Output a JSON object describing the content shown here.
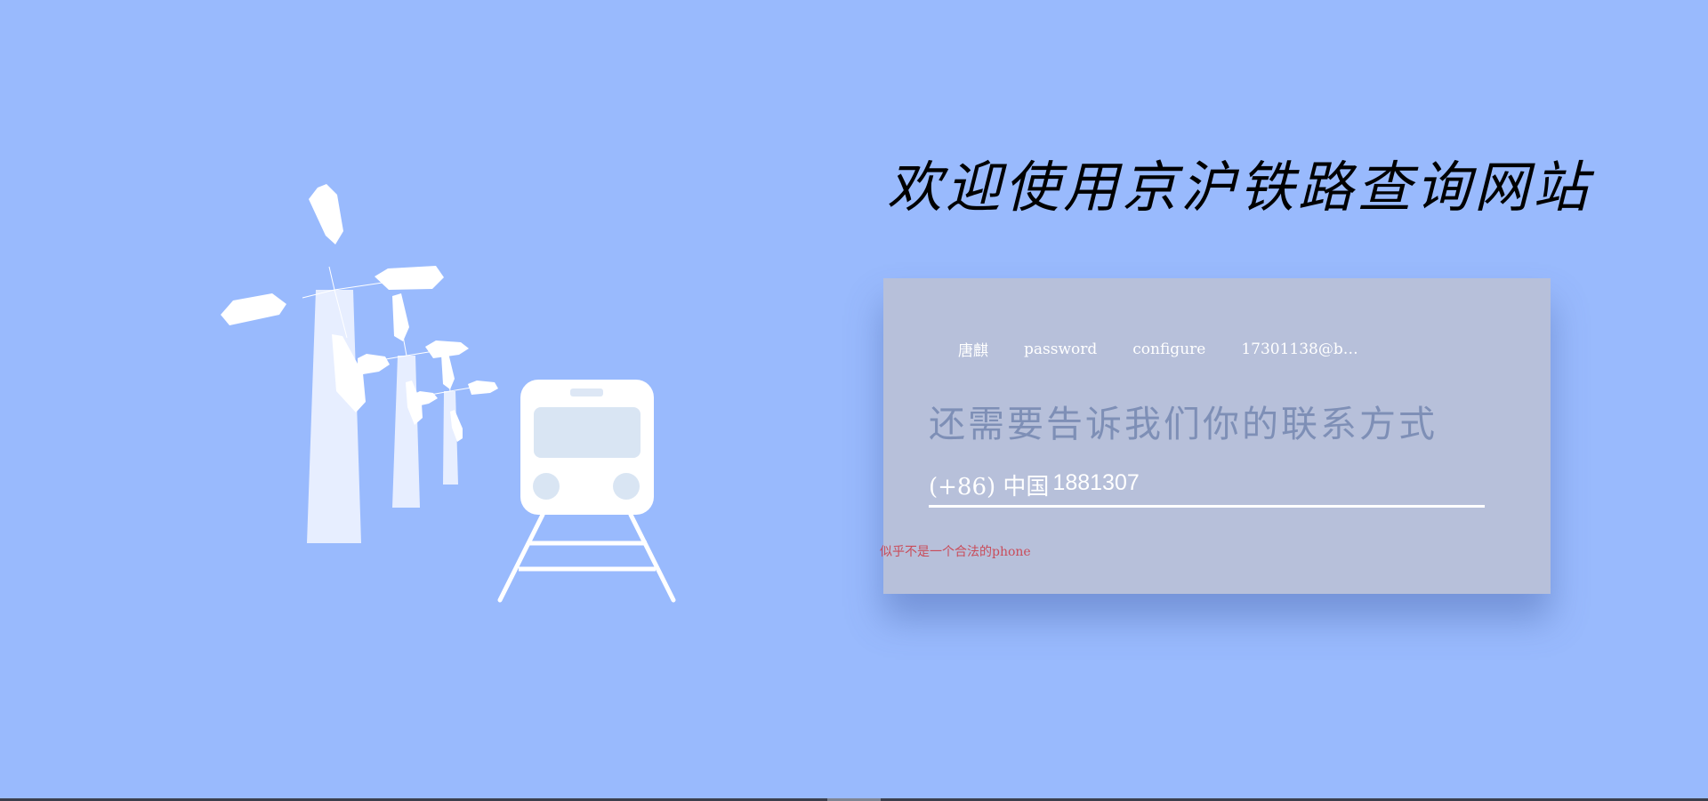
{
  "header": {
    "title": "欢迎使用京沪铁路查询网站"
  },
  "illustration": {
    "icon": "windmill-train-illustration",
    "color": "#ffffff"
  },
  "form": {
    "steps": [
      {
        "label": "唐麒"
      },
      {
        "label": "password"
      },
      {
        "label": "configure"
      },
      {
        "label": "17301138@b…"
      }
    ],
    "question": "还需要告诉我们你的联系方式",
    "phone": {
      "prefix": "(+86) 中国",
      "value": "1881307"
    },
    "error": "似乎不是一个合法的phone"
  },
  "colors": {
    "background": "#99bafd",
    "card": "#b7c0da",
    "question_text": "#7e8fb6",
    "error_text": "#c94c5a"
  }
}
